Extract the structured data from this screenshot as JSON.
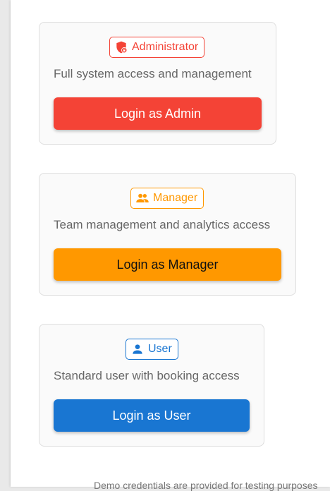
{
  "roles": {
    "admin": {
      "badge": "Administrator",
      "description": "Full system access and management",
      "button_label": "Login as Admin",
      "color": "#f44336",
      "icon": "shield-lock-icon"
    },
    "manager": {
      "badge": "Manager",
      "description": "Team management and analytics access",
      "button_label": "Login as Manager",
      "color": "#ff9800",
      "icon": "people-icon"
    },
    "user": {
      "badge": "User",
      "description": "Standard user with booking access",
      "button_label": "Login as User",
      "color": "#1976d2",
      "icon": "person-icon"
    }
  },
  "footer_note": "Demo credentials are provided for testing purposes"
}
